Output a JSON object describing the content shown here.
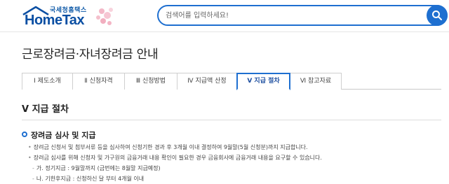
{
  "header": {
    "logo_sub": "국세청홈택스",
    "logo_main": "HomeTax",
    "search_placeholder": "검색어를 입력하세요!"
  },
  "page_title": "근로장려금·자녀장려금 안내",
  "tabs": [
    {
      "label": "Ⅰ  제도소개",
      "active": false
    },
    {
      "label": "Ⅱ  신청자격",
      "active": false
    },
    {
      "label": "Ⅲ  신청방법",
      "active": false
    },
    {
      "label": "Ⅳ  지급액 산정",
      "active": false
    },
    {
      "label": "Ⅴ  지급 절차",
      "active": true
    },
    {
      "label": "Ⅵ  참고자료",
      "active": false
    }
  ],
  "section_heading": "Ⅴ 지급 절차",
  "subsection": {
    "heading": "장려금 심사 및 지급",
    "lines": [
      {
        "bullet": "•",
        "text": "장려금 신청서 및 첨부서류 등을 심사하여 신청기한 경과 후 3개월 이내 결정하여 9월말(5월 신청분)까지 지급합니다."
      },
      {
        "bullet": "•",
        "text": "장려금 심사를 위해 신청자 및 가구원의 금융거래 내용 확인이 필요한 경우 금융회사에 금융거래 내용을 요구할 수 있습니다."
      },
      {
        "bullet": "-",
        "text": "가. 정기지급 : 9월말까지 (금번에는 8월말 지급예정)"
      },
      {
        "bullet": "-",
        "text": "나. 기한후지급 : 신청하신 달 부터 4개월 이내"
      }
    ]
  },
  "colors": {
    "accent": "#1e6fd0",
    "logo": "#0b4fa3"
  }
}
